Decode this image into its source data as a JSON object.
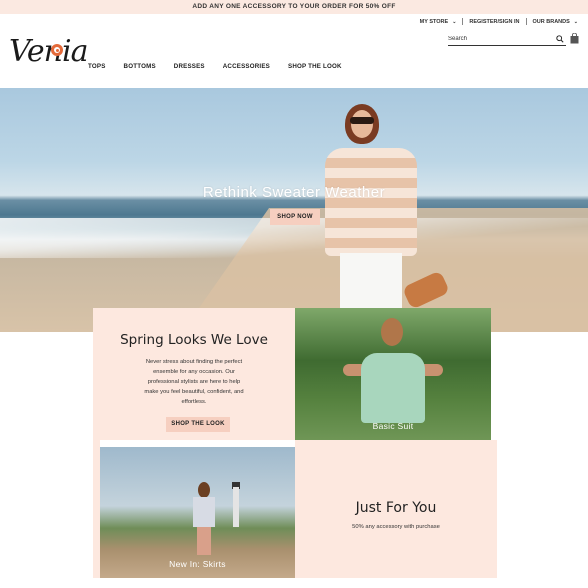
{
  "promo": {
    "text": "ADD ANY ONE ACCESSORY TO YOUR ORDER FOR 50% OFF"
  },
  "util_nav": {
    "store": "MY STORE",
    "account": "REGISTER/SIGN IN",
    "brands": "OUR BRANDS"
  },
  "logo": {
    "text": "Venia"
  },
  "nav": {
    "items": [
      "TOPS",
      "BOTTOMS",
      "DRESSES",
      "ACCESSORIES",
      "SHOP THE LOOK"
    ]
  },
  "search": {
    "placeholder": "Search"
  },
  "hero": {
    "title": "Rethink Sweater Weather",
    "cta": "SHOP NOW"
  },
  "spring": {
    "title": "Spring Looks We Love",
    "body": "Never stress about finding the perfect ensemble for any occasion. Our professional stylists are here to help make you feel beautiful, confident, and effortless.",
    "cta": "SHOP THE LOOK"
  },
  "tiles": {
    "basic": "Basic Suit",
    "skirts": "New In: Skirts"
  },
  "just_for_you": {
    "title": "Just For You",
    "subtitle": "50% any accessory with purchase"
  },
  "colors": {
    "accent": "#f6cfc0",
    "promo_bg": "#fbe9e1",
    "panel_bg": "#fde8df",
    "logo_orange": "#e46a3a"
  }
}
